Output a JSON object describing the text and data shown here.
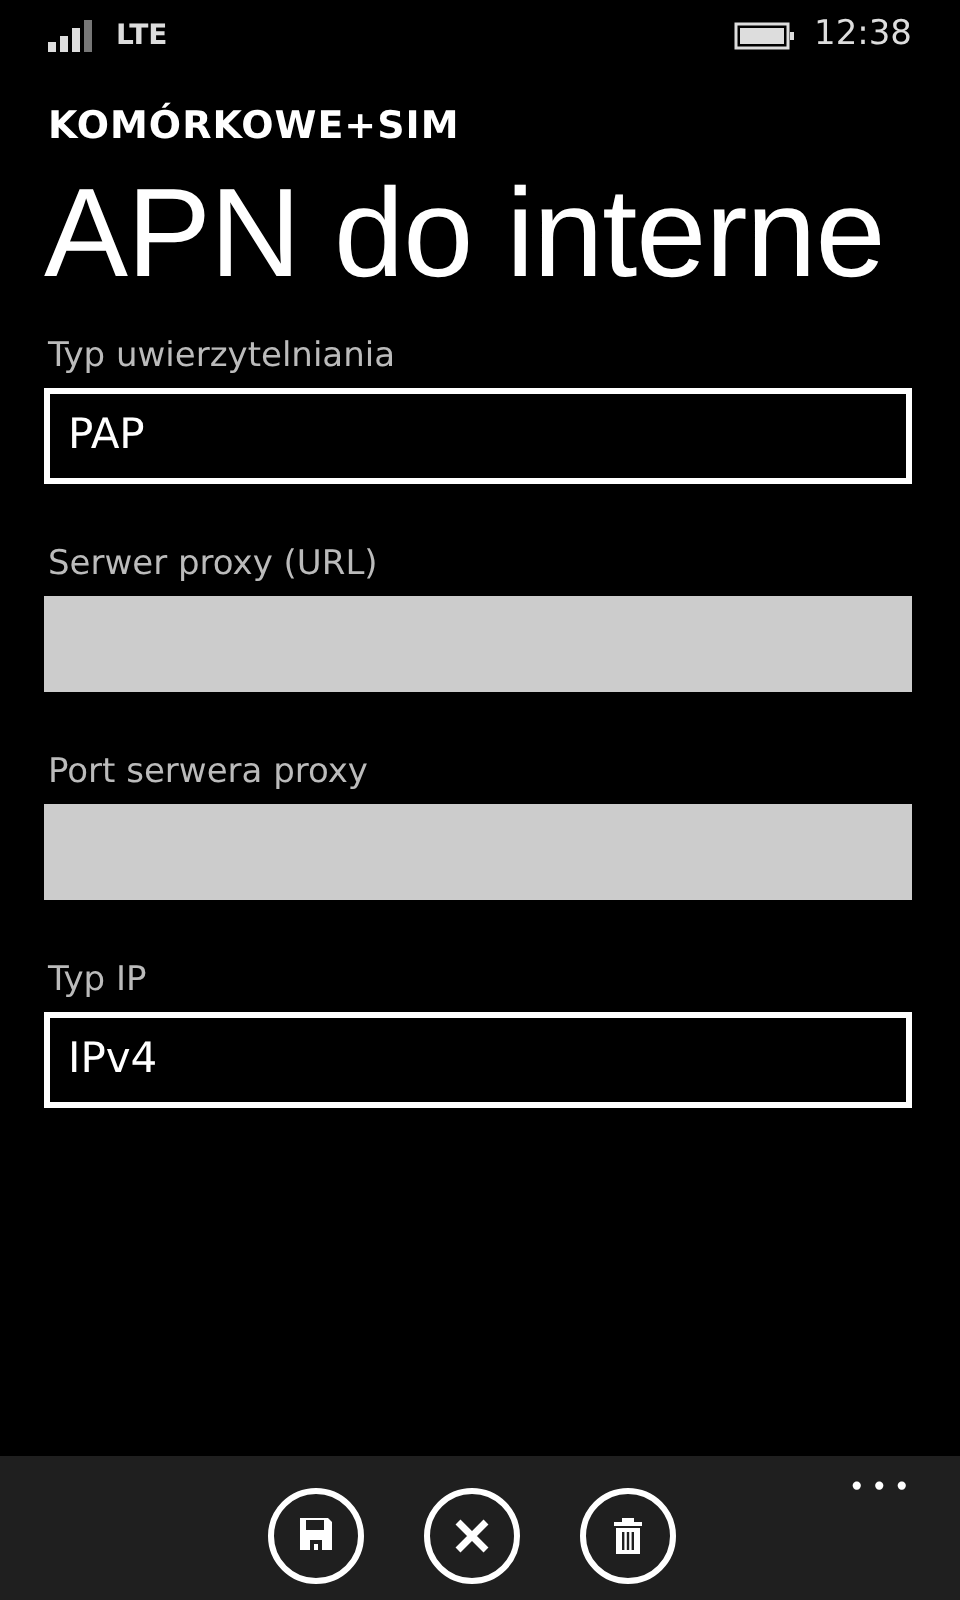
{
  "status_bar": {
    "network": "LTE",
    "time": "12:38"
  },
  "header": {
    "app_title": "KOMÓRKOWE+SIM",
    "page_title": "APN do interne"
  },
  "fields": [
    {
      "label": "Typ uwierzytelniania",
      "kind": "picker",
      "value": "PAP"
    },
    {
      "label": "Serwer proxy (URL)",
      "kind": "textbox"
    },
    {
      "label": "Port serwera proxy",
      "kind": "textbox"
    },
    {
      "label": "Typ IP",
      "kind": "picker",
      "value": "IPv4"
    }
  ],
  "app_bar": {
    "buttons": [
      {
        "kind": "save"
      },
      {
        "kind": "cancel"
      },
      {
        "kind": "delete"
      }
    ],
    "more": "•••"
  }
}
